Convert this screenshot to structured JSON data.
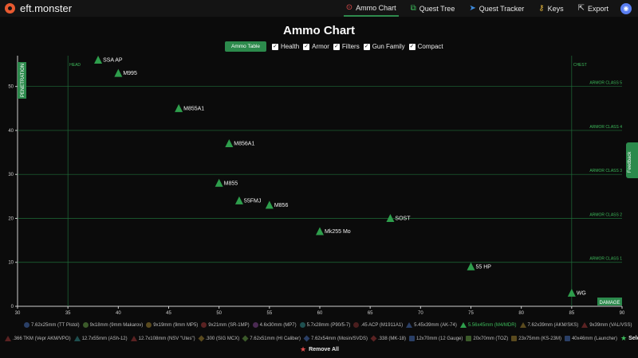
{
  "app": {
    "name": "eft.monster"
  },
  "nav": [
    {
      "label": "Ammo Chart",
      "icon": "target-icon",
      "active": true
    },
    {
      "label": "Quest Tree",
      "icon": "tree-icon"
    },
    {
      "label": "Quest Tracker",
      "icon": "paper-plane-icon"
    },
    {
      "label": "Keys",
      "icon": "key-icon"
    },
    {
      "label": "Export",
      "icon": "export-icon"
    }
  ],
  "page": {
    "title": "Ammo Chart"
  },
  "controls": {
    "ammo_table_label": "Ammo Table",
    "checks": [
      {
        "label": "Health",
        "checked": true
      },
      {
        "label": "Armor",
        "checked": true
      },
      {
        "label": "Filters",
        "checked": true
      },
      {
        "label": "Gun Family",
        "checked": true
      },
      {
        "label": "Compact",
        "checked": true
      }
    ]
  },
  "feedback": {
    "label": "Feedback"
  },
  "chart_data": {
    "type": "scatter",
    "title": "",
    "xlabel": "DAMAGE",
    "ylabel": "PENETRATION",
    "xlim": [
      30,
      90
    ],
    "ylim": [
      0,
      57
    ],
    "xticks": [
      30,
      35,
      40,
      45,
      50,
      55,
      60,
      65,
      70,
      75,
      80,
      85,
      90
    ],
    "yticks": [
      0,
      10,
      20,
      30,
      40,
      50
    ],
    "grid": false,
    "armor_class_lines": [
      {
        "label": "ARMOR CLASS 1",
        "y": 10
      },
      {
        "label": "ARMOR CLASS 2",
        "y": 20
      },
      {
        "label": "ARMOR CLASS 3",
        "y": 30
      },
      {
        "label": "ARMOR CLASS 4",
        "y": 40
      },
      {
        "label": "ARMOR CLASS 5",
        "y": 50
      }
    ],
    "vertical_lines": [
      {
        "label": "HEAD",
        "x": 35
      },
      {
        "label": "CHEST",
        "x": 85
      }
    ],
    "marker_color": "#2e9e4c",
    "series": [
      {
        "points": [
          {
            "label": "SSA AP",
            "damage": 38,
            "penetration": 56
          },
          {
            "label": "M995",
            "damage": 40,
            "penetration": 53
          },
          {
            "label": "M855A1",
            "damage": 46,
            "penetration": 45
          },
          {
            "label": "M856A1",
            "damage": 51,
            "penetration": 37
          },
          {
            "label": "M855",
            "damage": 50,
            "penetration": 28
          },
          {
            "label": "55FMJ",
            "damage": 52,
            "penetration": 24
          },
          {
            "label": "M856",
            "damage": 55,
            "penetration": 23
          },
          {
            "label": "SOST",
            "damage": 67,
            "penetration": 20
          },
          {
            "label": "Mk255 Mo",
            "damage": 60,
            "penetration": 17
          },
          {
            "label": "55 HP",
            "damage": 75,
            "penetration": 9
          },
          {
            "label": "WG",
            "damage": 85,
            "penetration": 3
          }
        ]
      }
    ]
  },
  "legend": {
    "row1": [
      {
        "label": "7.62x25mm (TT Pistol)",
        "shape": "circle",
        "color": "#2a3f66"
      },
      {
        "label": "9x18mm (9mm Makarov)",
        "shape": "circle",
        "color": "#3b5a2a"
      },
      {
        "label": "9x19mm (9mm MP5)",
        "shape": "circle",
        "color": "#5a4a1e"
      },
      {
        "label": "9x21mm (SR-1MP)",
        "shape": "circle",
        "color": "#5a2222"
      },
      {
        "label": "4.6x30mm (MP7)",
        "shape": "circle",
        "color": "#4a2a52"
      },
      {
        "label": "5.7x28mm (P90/5-7)",
        "shape": "circle",
        "color": "#1e4f4f"
      },
      {
        "label": ".45 ACP (M1911A1)",
        "shape": "circle",
        "color": "#4a1e1e"
      },
      {
        "label": "5.45x39mm (AK-74)",
        "shape": "triangle",
        "color": "#2a3f66"
      },
      {
        "label": "5.56x45mm (M4/MDR)",
        "shape": "triangle",
        "color": "#2e9e4c",
        "active": true
      },
      {
        "label": "7.62x39mm (AKM/SKS)",
        "shape": "triangle",
        "color": "#5a4a1e"
      },
      {
        "label": "9x39mm (VAL/VSS)",
        "shape": "triangle",
        "color": "#5a2222"
      }
    ],
    "row2": [
      {
        "label": ".366 TKM (Vepr AKM/VPO)",
        "shape": "triangle",
        "color": "#5a2222"
      },
      {
        "label": "12.7x55mm (ASh-12)",
        "shape": "triangle",
        "color": "#1e4f4f"
      },
      {
        "label": "12.7x108mm (NSV \"Utes\")",
        "shape": "triangle",
        "color": "#5a2222"
      },
      {
        "label": ".300 (SIG MCX)",
        "shape": "diamond",
        "color": "#5a4a1e"
      },
      {
        "label": "7.62x51mm (HI Caliber)",
        "shape": "diamond",
        "color": "#3b5a2a"
      },
      {
        "label": "7.62x54mm (Mosin/SVDS)",
        "shape": "diamond",
        "color": "#2a3f66"
      },
      {
        "label": ".338 (MK-18)",
        "shape": "diamond",
        "color": "#5a2222"
      },
      {
        "label": "12x70mm (12 Gauge)",
        "shape": "square",
        "color": "#2a3f66"
      },
      {
        "label": "20x70mm (TOZ)",
        "shape": "square",
        "color": "#3b5a2a"
      },
      {
        "label": "23x75mm (KS-23M)",
        "shape": "square",
        "color": "#5a4a1e"
      },
      {
        "label": "40x46mm (Launcher)",
        "shape": "square",
        "color": "#2a3f66"
      }
    ],
    "select_all_label": "Select All",
    "remove_all_label": "Remove All"
  }
}
